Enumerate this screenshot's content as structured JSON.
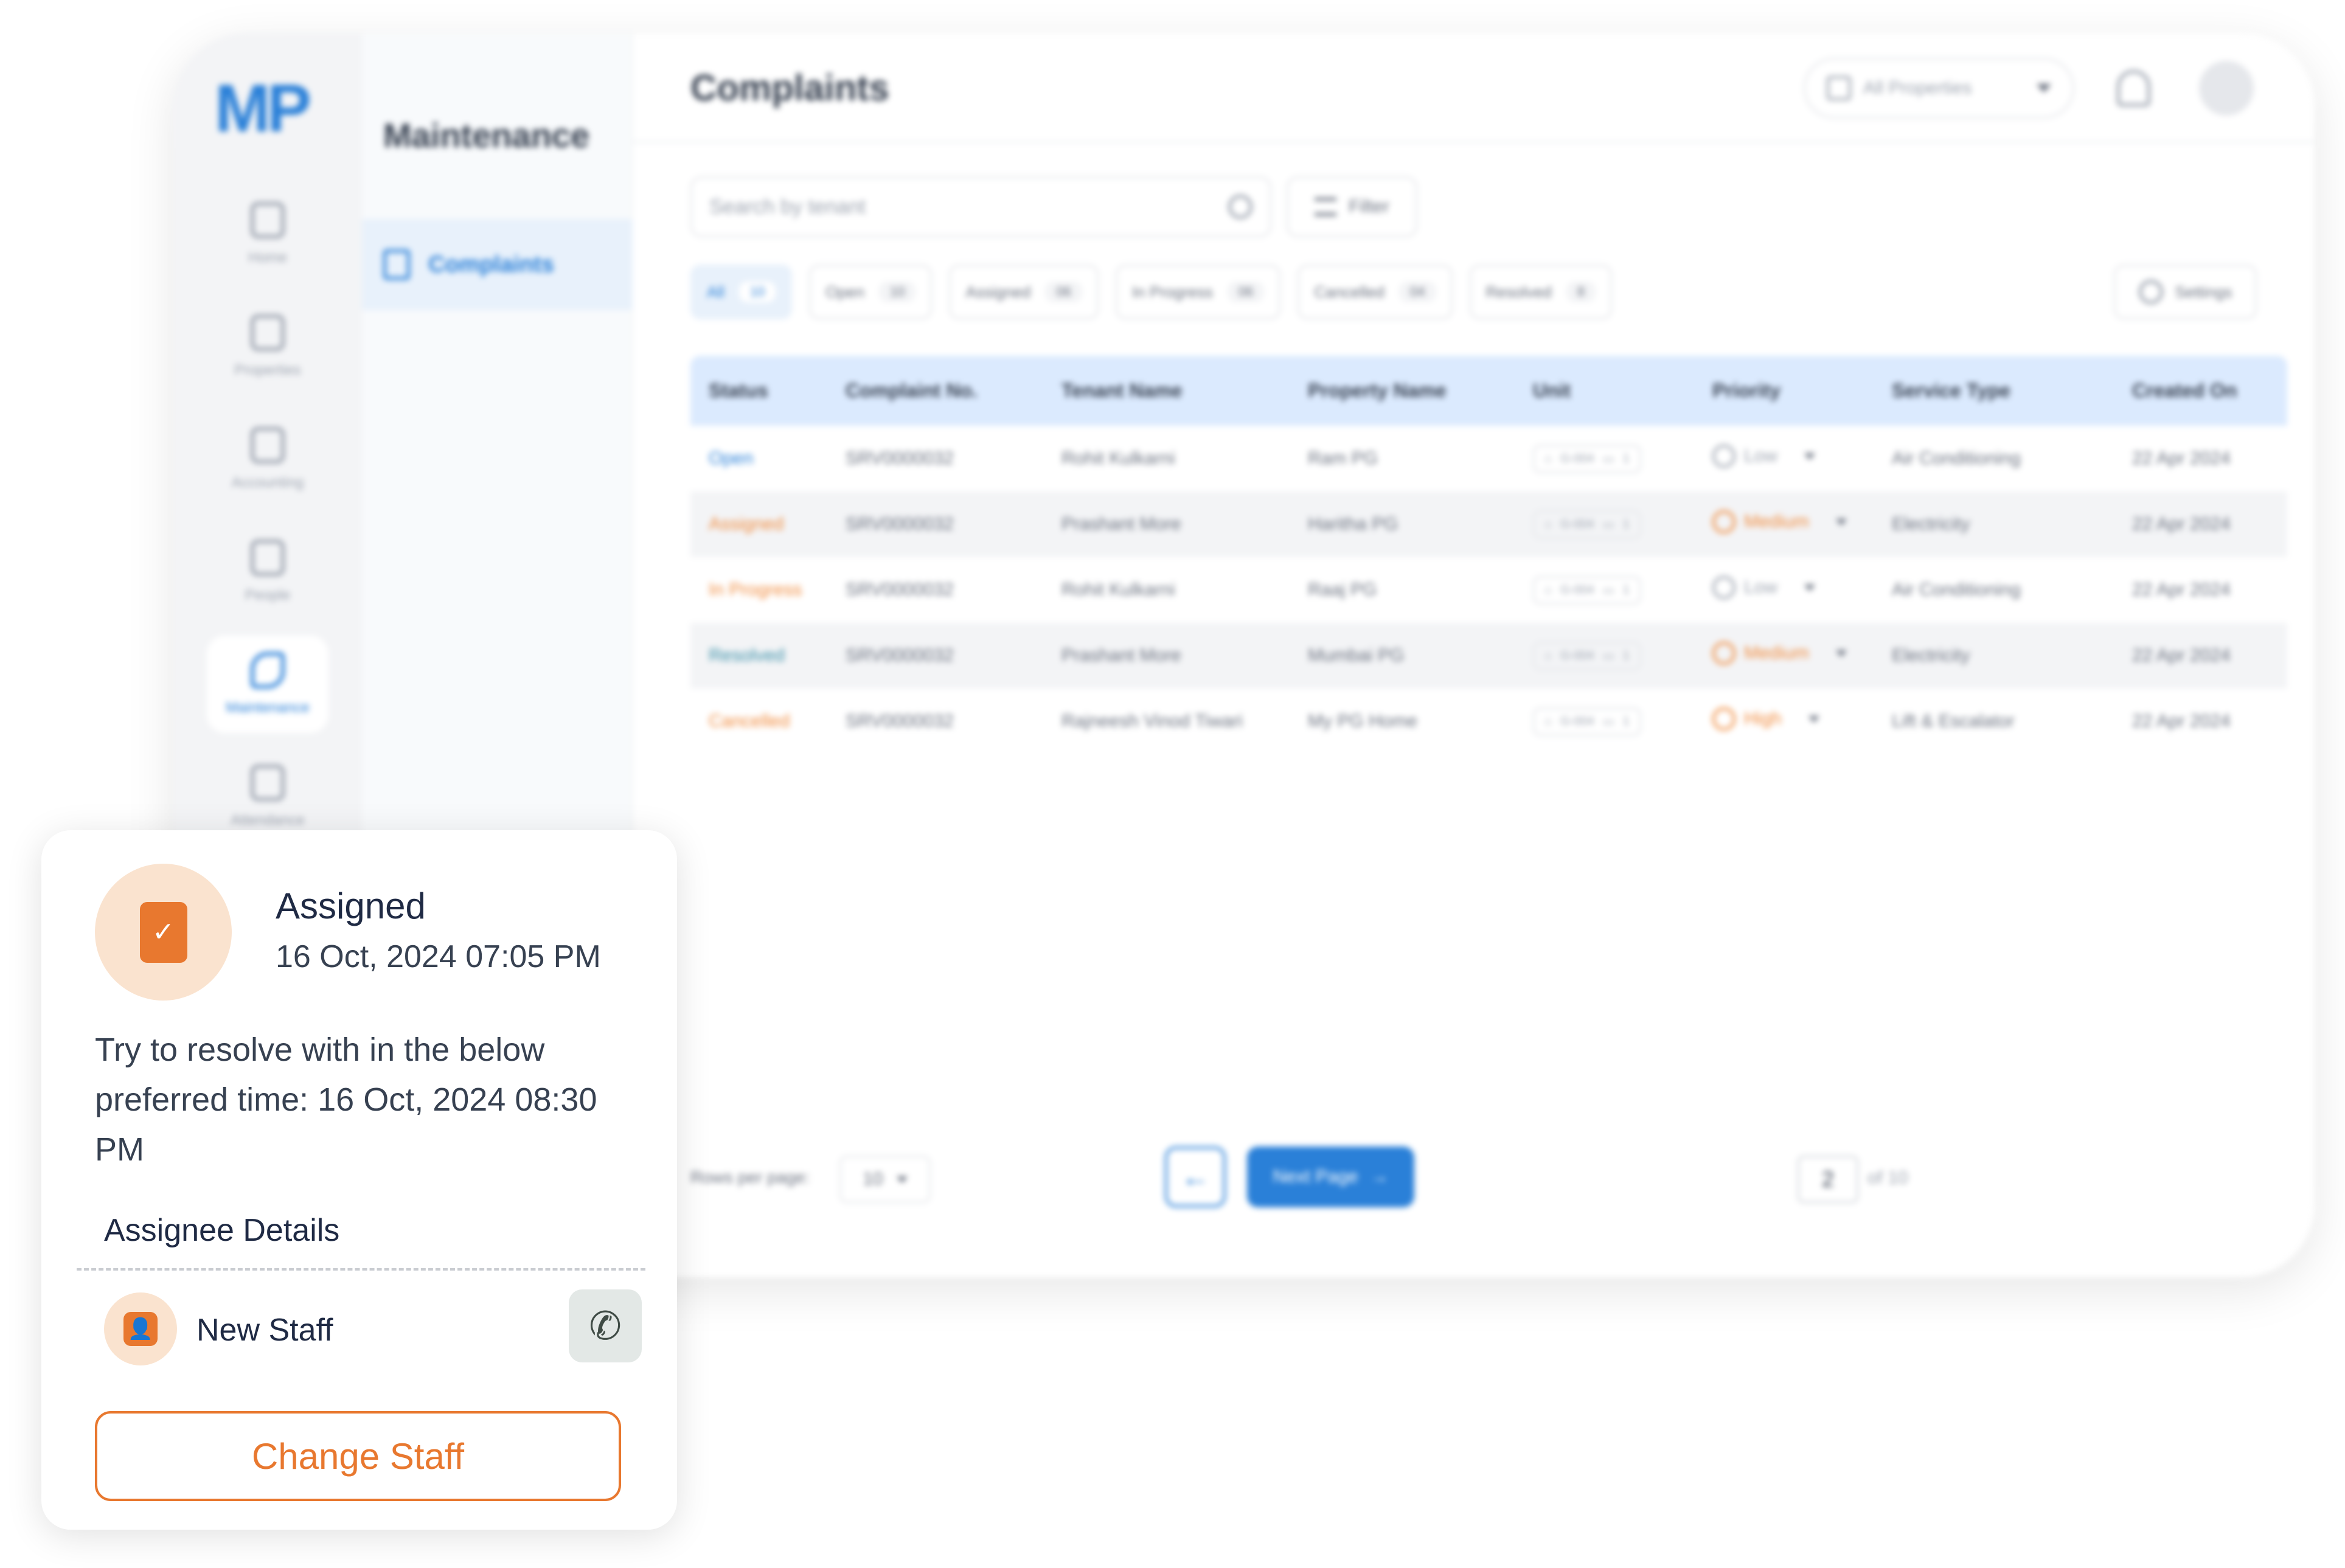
{
  "app": {
    "logo": "MP",
    "rail": [
      {
        "label": "Home",
        "icon": "home-icon"
      },
      {
        "label": "Properties",
        "icon": "building-icon"
      },
      {
        "label": "Accounting",
        "icon": "calculator-icon"
      },
      {
        "label": "People",
        "icon": "people-icon"
      },
      {
        "label": "Maintenance",
        "icon": "wrench-icon",
        "active": true
      },
      {
        "label": "Attendance",
        "icon": "calendar-icon"
      }
    ],
    "subnav": {
      "title": "Maintenance",
      "item": "Complaints"
    },
    "page_title": "Complaints",
    "property_select": "All Properties",
    "search_placeholder": "Search by tenant",
    "filter_label": "Filter",
    "settings_label": "Settings",
    "tabs": [
      {
        "label": "All",
        "count": "10",
        "active": true
      },
      {
        "label": "Open",
        "count": "10"
      },
      {
        "label": "Assigned",
        "count": "06"
      },
      {
        "label": "In Progress",
        "count": "06"
      },
      {
        "label": "Cancelled",
        "count": "04"
      },
      {
        "label": "Resolved",
        "count": "8"
      }
    ],
    "table": {
      "headers": [
        "Status",
        "Complaint No.",
        "Tenant Name",
        "Property Name",
        "Unit",
        "Priority",
        "Service Type",
        "Created On"
      ],
      "rows": [
        {
          "status": "Open",
          "status_color": "#2a80d8",
          "no": "SRV0000032",
          "tenant": "Rohit Kulkarni",
          "property": "Ram PG",
          "unit_a": "G-004",
          "unit_b": "1",
          "priority": "Low",
          "priority_color": "#9ca3af",
          "service": "Air Conditioning",
          "created": "22 Apr 2024"
        },
        {
          "status": "Assigned",
          "status_color": "#f08a3c",
          "no": "SRV0000032",
          "tenant": "Prashant More",
          "property": "Haritha PG",
          "unit_a": "G-004",
          "unit_b": "1",
          "priority": "Medium",
          "priority_color": "#f08a3c",
          "service": "Electricity",
          "created": "22 Apr 2024"
        },
        {
          "status": "In Progress",
          "status_color": "#f08a3c",
          "no": "SRV0000032",
          "tenant": "Rohit Kulkarni",
          "property": "Raaj PG",
          "unit_a": "G-004",
          "unit_b": "1",
          "priority": "Low",
          "priority_color": "#9ca3af",
          "service": "Air Conditioning",
          "created": "22 Apr 2024"
        },
        {
          "status": "Resolved",
          "status_color": "#3a8fa8",
          "no": "SRV0000032",
          "tenant": "Prashant More",
          "property": "Mumbai PG",
          "unit_a": "G-004",
          "unit_b": "1",
          "priority": "Medium",
          "priority_color": "#f08a3c",
          "service": "Electricity",
          "created": "22 Apr 2024"
        },
        {
          "status": "Cancelled",
          "status_color": "#f08a3c",
          "no": "SRV0000032",
          "tenant": "Rajneesh Vinod Tiwari",
          "property": "My PG Home",
          "unit_a": "G-004",
          "unit_b": "1",
          "priority": "High",
          "priority_color": "#f08a3c",
          "service": "Lift & Escalator",
          "created": "22 Apr 2024"
        }
      ]
    },
    "pager": {
      "rows_label": "Rows per page:",
      "rows_value": "10",
      "prev_arrow": "←",
      "next_label": "Next Page",
      "next_arrow": "→",
      "page": "2",
      "of_label": "of 10"
    }
  },
  "card": {
    "status_title": "Assigned",
    "status_time": "16 Oct, 2024 07:05 PM",
    "badge_glyph": "✓",
    "message": "Try to resolve with in the below preferred  time: 16 Oct, 2024 08:30 PM",
    "section_title": "Assignee Details",
    "staff_name": "New Staff",
    "staff_glyph": "👤",
    "call_glyph": "✆",
    "change_label": "Change Staff"
  },
  "colors": {
    "accent_orange": "#e8782f",
    "brand_blue": "#2a80d8"
  }
}
